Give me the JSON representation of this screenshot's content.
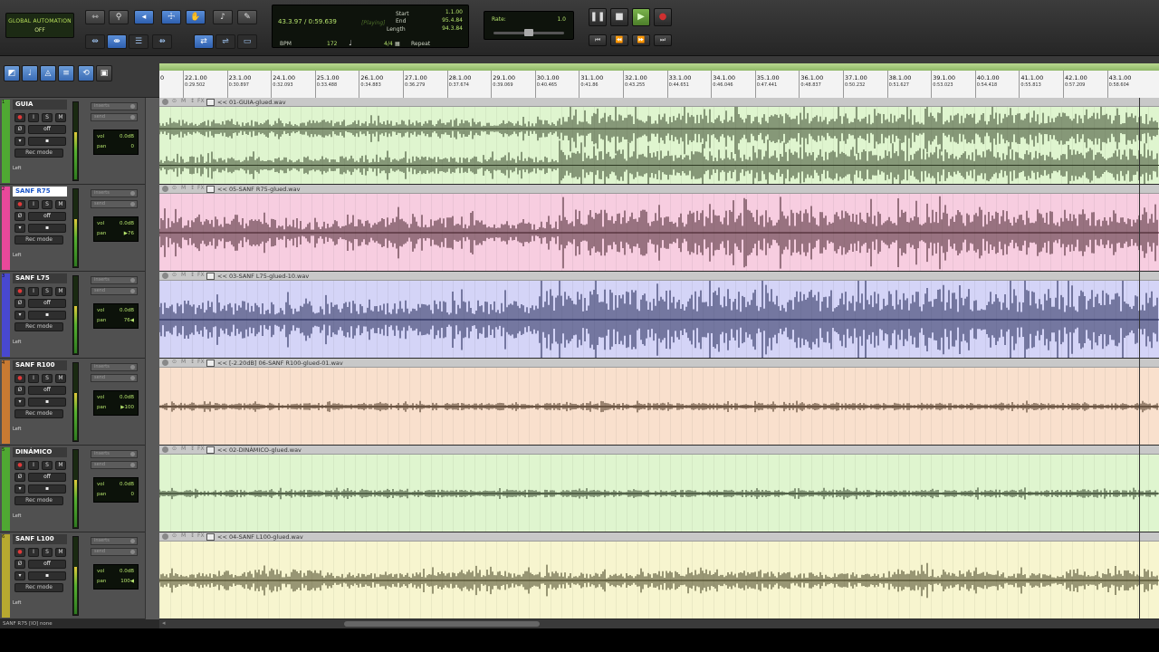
{
  "toolbar": {
    "global_automation": {
      "title": "GLOBAL AUTOMATION",
      "value": "OFF"
    },
    "tool_icons": [
      "zoom-preset-icon",
      "zoomer-icon",
      "trim-icon",
      "grabber-icon",
      "hand-icon",
      "speaker-icon",
      "pencil-icon",
      "shuffle-icon",
      "spot-icon",
      "slip-icon",
      "grid-icon",
      "nudge-icon",
      "link-icon",
      "insert-follow-icon",
      "loop-icon"
    ]
  },
  "counter": {
    "main": "43.3.97 / 0:59.639",
    "playing": "[Playing]",
    "start_label": "Start",
    "start_value": "1.1.00",
    "end_label": "End",
    "end_value": "95.4.84",
    "length_label": "Length",
    "length_value": "94.3.84",
    "bpm_label": "BPM",
    "bpm_value": "172",
    "meter": "4/4",
    "repeat_label": "Repeat"
  },
  "rate": {
    "label": "Rate:",
    "value": "1.0",
    "level": 0.5
  },
  "transport": {
    "pause": "pause-icon",
    "stop": "stop-icon",
    "play": "play-icon",
    "record": "record-icon",
    "rewind_start": "go-to-start-icon",
    "rewind": "rewind-icon",
    "forward": "fast-forward-icon",
    "end": "go-to-end-icon"
  },
  "ruler": {
    "start_mark": "0",
    "bars": [
      {
        "bar": "22.1.00",
        "time": "0:29.502"
      },
      {
        "bar": "23.1.00",
        "time": "0:30.897"
      },
      {
        "bar": "24.1.00",
        "time": "0:32.093"
      },
      {
        "bar": "25.1.00",
        "time": "0:33.488"
      },
      {
        "bar": "26.1.00",
        "time": "0:34.883"
      },
      {
        "bar": "27.1.00",
        "time": "0:36.279"
      },
      {
        "bar": "28.1.00",
        "time": "0:37.674"
      },
      {
        "bar": "29.1.00",
        "time": "0:39.069"
      },
      {
        "bar": "30.1.00",
        "time": "0:40.465"
      },
      {
        "bar": "31.1.00",
        "time": "0:41.86"
      },
      {
        "bar": "32.1.00",
        "time": "0:43.255"
      },
      {
        "bar": "33.1.00",
        "time": "0:44.651"
      },
      {
        "bar": "34.1.00",
        "time": "0:46.046"
      },
      {
        "bar": "35.1.00",
        "time": "0:47.441"
      },
      {
        "bar": "36.1.00",
        "time": "0:48.837"
      },
      {
        "bar": "37.1.00",
        "time": "0:50.232"
      },
      {
        "bar": "38.1.00",
        "time": "0:51.627"
      },
      {
        "bar": "39.1.00",
        "time": "0:53.023"
      },
      {
        "bar": "40.1.00",
        "time": "0:54.418"
      },
      {
        "bar": "41.1.00",
        "time": "0:55.813"
      },
      {
        "bar": "42.1.00",
        "time": "0:57.209"
      },
      {
        "bar": "43.1.00",
        "time": "0:58.604"
      }
    ]
  },
  "tracks": [
    {
      "num": "1",
      "name": "GUIA",
      "selected": false,
      "color": "#4fa832",
      "lane_color": "#dff5cf",
      "wave_color": "#2e3a22",
      "clip": "<< 01-GUIA-glued.wav",
      "vol": "0.0dB",
      "pan": "0",
      "rec_mode": "Rec mode",
      "automation": "off",
      "note": "Left",
      "stereo": true,
      "env": "g",
      "amp": 0.18
    },
    {
      "num": "2",
      "name": "SANF R75",
      "selected": true,
      "color": "#e8489a",
      "lane_color": "#f7cde0",
      "wave_color": "#3a1820",
      "clip": "<< 05-SANF R75-glued.wav",
      "vol": "0.0dB",
      "pan": "▶76",
      "rec_mode": "Rec mode",
      "automation": "off",
      "note": "Left",
      "stereo": false,
      "env": "r75",
      "amp": 0.22
    },
    {
      "num": "3",
      "name": "SANF L75",
      "selected": false,
      "color": "#4848d0",
      "lane_color": "#d4d4f7",
      "wave_color": "#141a4a",
      "clip": "<< 03-SANF L75-glued-10.wav",
      "vol": "0.0dB",
      "pan": "76◀",
      "rec_mode": "Rec mode",
      "automation": "off",
      "note": "Left",
      "stereo": false,
      "env": "l75",
      "amp": 0.26
    },
    {
      "num": "4",
      "name": "SANF R100",
      "selected": false,
      "color": "#c87a32",
      "lane_color": "#f9e0cd",
      "wave_color": "#3a2614",
      "clip": "<< [-2.20dB] 06-SANF R100-glued-01.wav",
      "vol": "0.0dB",
      "pan": "▶100",
      "rec_mode": "Rec mode",
      "automation": "off",
      "note": "Left",
      "stereo": false,
      "env": "flat",
      "amp": 0.05
    },
    {
      "num": "5",
      "name": "DINÁMICO",
      "selected": false,
      "color": "#4fa832",
      "lane_color": "#dff5cf",
      "wave_color": "#24321c",
      "clip": "<< 02-DINÁMICO-glued.wav",
      "vol": "0.0dB",
      "pan": "0",
      "rec_mode": "Rec mode",
      "automation": "off",
      "note": "Left",
      "stereo": false,
      "env": "flat",
      "amp": 0.05
    },
    {
      "num": "6",
      "name": "SANF L100",
      "selected": false,
      "color": "#b7a830",
      "lane_color": "#f7f5cf",
      "wave_color": "#3a3618",
      "clip": "<< 04-SANF L100-glued.wav",
      "vol": "0.0dB",
      "pan": "100◀",
      "rec_mode": "Rec mode",
      "automation": "off",
      "note": "Left",
      "stereo": false,
      "env": "l100",
      "amp": 0.1
    }
  ],
  "labels": {
    "inserts": "inserts",
    "sends": "send",
    "vol": "vol",
    "pan": "pan",
    "solo": "S",
    "mute": "M",
    "input": "I",
    "phase": "Ø"
  },
  "status": "SANF R75 [IO] none"
}
